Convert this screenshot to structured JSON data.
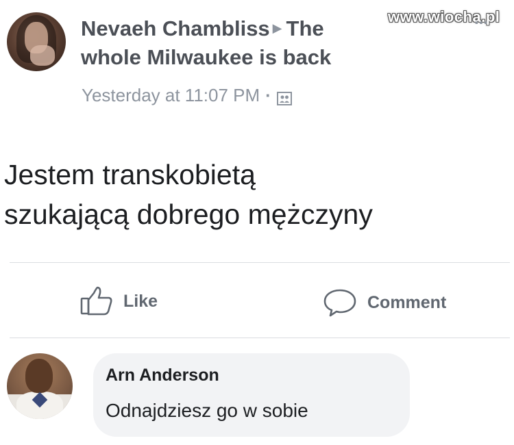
{
  "post": {
    "author": "Nevaeh Chambliss",
    "group_prefix": "The",
    "group_rest": "whole Milwaukee is back",
    "timestamp": "Yesterday at 11:07 PM",
    "separator": "·",
    "audience_icon": "group-audience-icon",
    "text_line_1": "Jestem transkobietą",
    "text_line_2": "szukającą dobrego mężczyny"
  },
  "watermark": "www.wiocha.pl",
  "overflow": "...",
  "actions": {
    "like_label": "Like",
    "comment_label": "Comment"
  },
  "comment": {
    "author": "Arn Anderson",
    "text": "Odnajdziesz go w sobie"
  },
  "colors": {
    "primary_text": "#1c1e21",
    "secondary_text": "#8d949e",
    "action_text": "#606770",
    "divider": "#dadde1",
    "bubble_bg": "#f2f3f5"
  }
}
